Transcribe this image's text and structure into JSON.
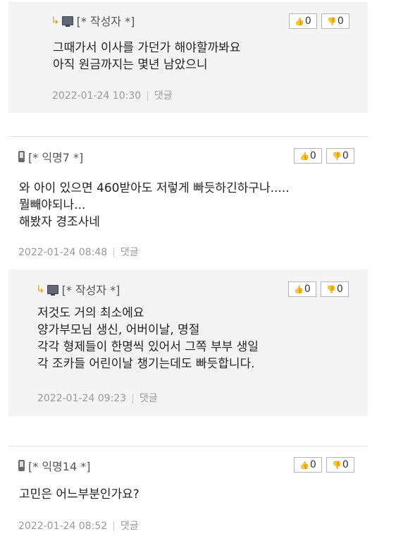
{
  "comments": [
    {
      "author": "[* 작성자 *]",
      "lines": [
        "그때가서 이사를 가던가 해야할까봐요",
        "아직 원금까지는 몇년 남았으니"
      ],
      "timestamp": "2022-01-24 10:30",
      "reply_label": "댓글",
      "upvotes": "0",
      "downvotes": "0",
      "is_reply": true,
      "device": "pc"
    },
    {
      "author": "[* 익명7 *]",
      "lines": [
        "와 아이 있으면 460받아도 저렇게 빠듯하긴하구나.....",
        "뭘빼야되나...",
        "해봤자 경조사네"
      ],
      "timestamp": "2022-01-24 08:48",
      "reply_label": "댓글",
      "upvotes": "0",
      "downvotes": "0",
      "is_reply": false,
      "device": "mobile"
    },
    {
      "author": "[* 작성자 *]",
      "lines": [
        "저것도 거의 최소에요",
        "양가부모님 생신, 어버이날, 명절",
        "각각 형제들이 한명씩 있어서 그쪽 부부 생일",
        "각 조카들 어린이날 챙기는데도 빠듯합니다."
      ],
      "timestamp": "2022-01-24 09:23",
      "reply_label": "댓글",
      "upvotes": "0",
      "downvotes": "0",
      "is_reply": true,
      "device": "pc"
    },
    {
      "author": "[* 익명14 *]",
      "lines": [
        "고민은 어느부분인가요?"
      ],
      "timestamp": "2022-01-24 08:52",
      "reply_label": "댓글",
      "upvotes": "0",
      "downvotes": "0",
      "is_reply": false,
      "device": "mobile"
    }
  ],
  "icons": {
    "reply_arrow": "reply-arrow-icon",
    "pc": "pc-icon",
    "mobile": "mobile-icon",
    "thumbs_up": "thumbs-up-icon",
    "thumbs_down": "thumbs-down-icon"
  },
  "colors": {
    "reply_background": "#f4f4f4",
    "reply_arrow": "#e8a21a",
    "meta_text": "#999999"
  }
}
